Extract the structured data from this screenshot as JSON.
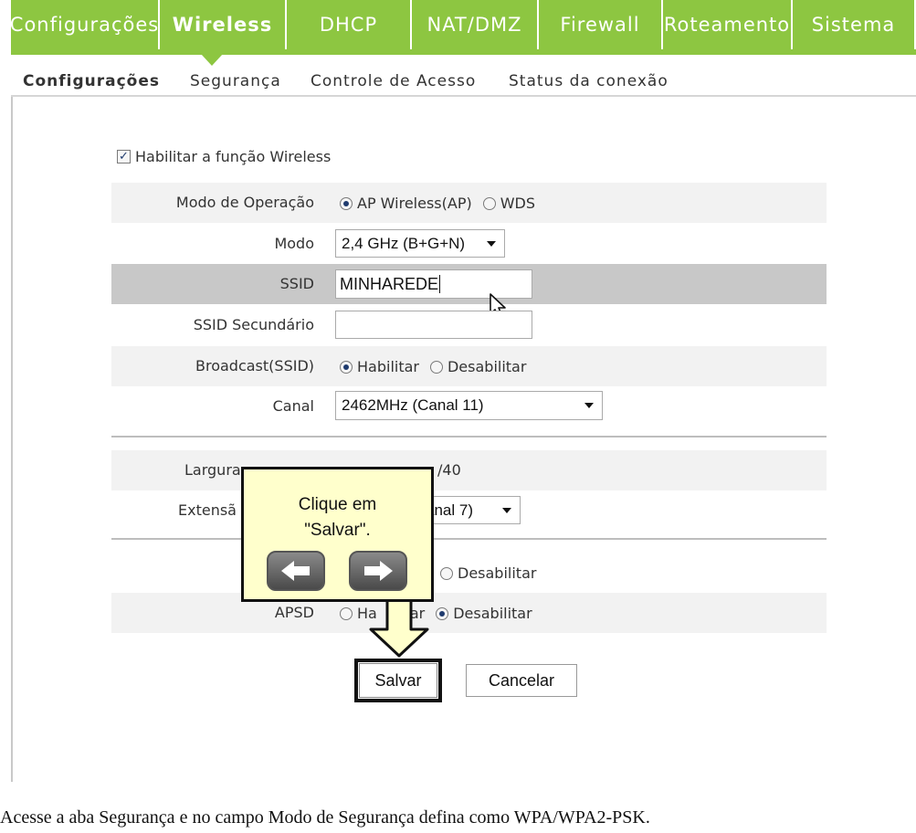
{
  "topnav": {
    "tabs": [
      "Configurações",
      "Wireless",
      "DHCP",
      "NAT/DMZ",
      "Firewall",
      "Roteamento",
      "Sistema"
    ],
    "active": "Wireless"
  },
  "subnav": {
    "tabs": [
      "Configurações",
      "Segurança",
      "Controle de Acesso",
      "Status da conexão"
    ],
    "active": "Configurações"
  },
  "form": {
    "enable_wireless": {
      "label": "Habilitar a função Wireless",
      "checked": true
    },
    "op_mode": {
      "label": "Modo de Operação",
      "options": [
        "AP Wireless(AP)",
        "WDS"
      ],
      "selected": "AP Wireless(AP)"
    },
    "mode": {
      "label": "Modo",
      "value": "2,4 GHz (B+G+N)"
    },
    "ssid": {
      "label": "SSID",
      "value": "MINHAREDE"
    },
    "ssid_secondary": {
      "label": "SSID Secundário",
      "value": ""
    },
    "broadcast": {
      "label": "Broadcast(SSID)",
      "options": [
        "Habilitar",
        "Desabilitar"
      ],
      "selected": "Habilitar"
    },
    "channel": {
      "label": "Canal",
      "value": "2462MHz (Canal 11)"
    },
    "bandwidth": {
      "label_visible": "Largura",
      "label_tail": "a",
      "option_visible": "/40"
    },
    "extension": {
      "label_visible": "Extensã",
      "value_visible": "anal 7)"
    },
    "wmm": {
      "option_visible": "Desabilitar"
    },
    "apsd": {
      "label": "APSD",
      "option1_visible": "Ha",
      "option1_tail": "ar",
      "option2": "Desabilitar",
      "selected": "Desabilitar"
    }
  },
  "buttons": {
    "save": "Salvar",
    "cancel": "Cancelar"
  },
  "tooltip": {
    "line1": "Clique em",
    "line2": "\"Salvar\"."
  },
  "caption": "Acesse a aba Segurança e no campo Modo de Segurança defina como WPA/WPA2-PSK.",
  "colors": {
    "nav_green": "#8dc641",
    "tooltip_bg": "#ffffcc",
    "ssid_row": "#c8c8c8"
  }
}
